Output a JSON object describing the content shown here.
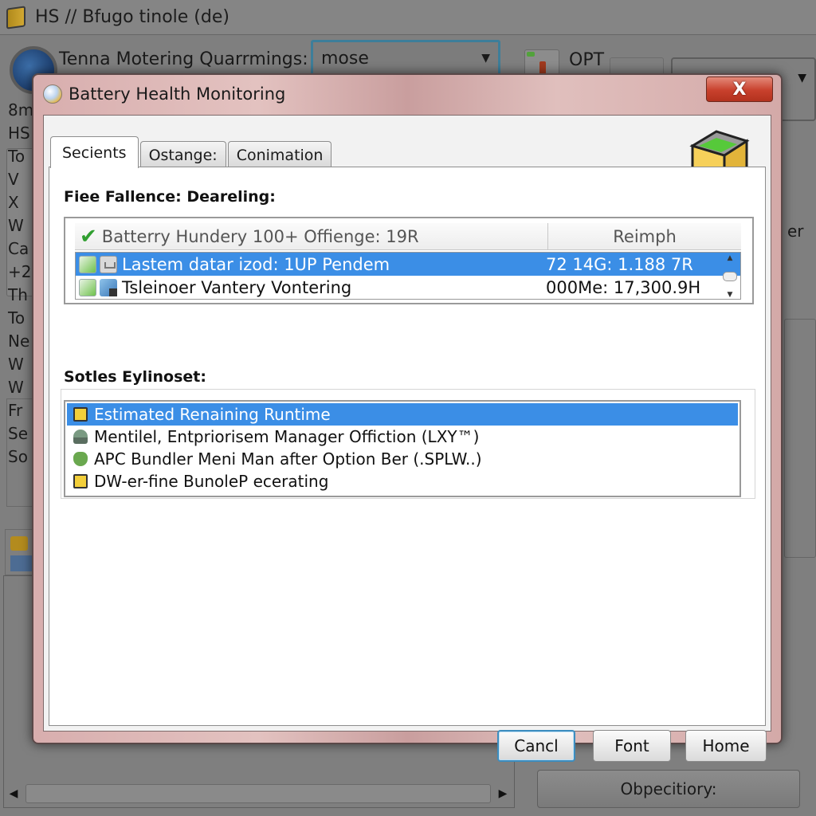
{
  "background_app": {
    "title": "HS // Bfugo tinole (de)",
    "toolbar_label": "Tenna Motering Quarrmings:",
    "combo_value": "mose",
    "opt_label": "OPT",
    "left_list": [
      "8m",
      "HS",
      "To",
      "V",
      "X",
      "W",
      "Ca",
      "+2",
      "Th",
      "To",
      "Ne",
      "W",
      "W",
      "Fr",
      "Se",
      "So"
    ],
    "right_side_label": "er",
    "right_button_label": "Obpecitiory:"
  },
  "dialog": {
    "title": "Battery Health Monitoring",
    "close_label": "X",
    "tabs": [
      {
        "label": "Secients",
        "active": true
      },
      {
        "label": "Ostange:",
        "active": false
      },
      {
        "label": "Conimation",
        "active": false
      }
    ],
    "section1_label": "Fiee Fallence: Deareling:",
    "list1": {
      "header_col1": "Batterry Hundery 100+ Offienge: 19R",
      "header_col2": "Reimph",
      "rows": [
        {
          "text": "Lastem datar izod: 1UP Pendem",
          "value": "72 14G: 1.188 7R",
          "selected": true
        },
        {
          "text": "Tsleinoer Vantery Vontering",
          "value": "000Me: 17,300.9H",
          "selected": false
        }
      ]
    },
    "section2_label": "Sotles Eylinoset:",
    "list2": {
      "rows": [
        {
          "icon": "folder-icon",
          "text": "Estimated  Renaining Runtime",
          "selected": true
        },
        {
          "icon": "user-icon",
          "text": "Mentilel, Entpriorisem Manager Offiction (LXY™)",
          "selected": false
        },
        {
          "icon": "shield-icon",
          "text": "APC Bundler Meni Man after Option Ber (.SPLW..)",
          "selected": false
        },
        {
          "icon": "folder-icon",
          "text": "DW-er-fine BunoleP ecerating",
          "selected": false
        }
      ]
    },
    "buttons": {
      "cancel": "Cancl",
      "font": "Font",
      "home": "Home"
    }
  }
}
